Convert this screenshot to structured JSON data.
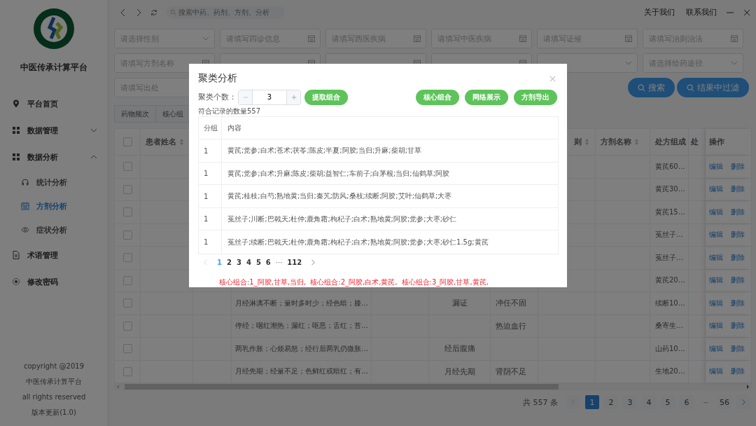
{
  "topbar": {
    "search": {
      "placeholder": "搜索中药、药剂、方剂、分析"
    },
    "links": [
      "关于我们",
      "联系我们"
    ]
  },
  "sidebar": {
    "title": "中医传承计算平台",
    "items": [
      {
        "label": "平台首页",
        "selected": false
      },
      {
        "label": "数据管理",
        "selected": false,
        "expanded": false
      },
      {
        "label": "数据分析",
        "selected": false,
        "expanded": true,
        "children": [
          {
            "label": "统计分析",
            "selected": false
          },
          {
            "label": "方剂分析",
            "selected": true
          },
          {
            "label": "症状分析",
            "selected": false
          }
        ]
      },
      {
        "label": "术语管理",
        "selected": false
      },
      {
        "label": "修改密码",
        "selected": false
      }
    ],
    "footer": [
      "copyright @2019",
      "中医传承计算平台",
      "all rights reserved",
      "版本更新(1.0)"
    ]
  },
  "filters": [
    {
      "kind": "select",
      "placeholder": "请选择性别"
    },
    {
      "kind": "date",
      "placeholder": "请填写四诊信息"
    },
    {
      "kind": "date",
      "placeholder": "请填写西医疾病"
    },
    {
      "kind": "date",
      "placeholder": "请填写中医疾病"
    },
    {
      "kind": "date",
      "placeholder": "请填写证候"
    },
    {
      "kind": "date",
      "placeholder": "请填写治则治法"
    },
    {
      "kind": "date",
      "placeholder": "请填写方剂名称"
    },
    {
      "kind": "date"
    },
    {
      "kind": "date"
    },
    {
      "kind": "date"
    },
    {
      "kind": "select"
    },
    {
      "kind": "select",
      "placeholder": "请选择给药途径"
    },
    {
      "kind": "text",
      "placeholder": "请填写出处"
    }
  ],
  "filter_buttons": [
    "搜索",
    "结果中过滤"
  ],
  "tabs": [
    {
      "label": "药物频次"
    },
    {
      "label": "核心组"
    }
  ],
  "table": {
    "all_checked": false,
    "headers": {
      "patient_name": {
        "label": "患者姓名",
        "sortable": true
      },
      "column_8": {
        "label": "则",
        "sortable": true
      },
      "formula_name": {
        "label": "方剂名称",
        "sortable": true
      },
      "composition": {
        "label": "处方组成",
        "sortable": false
      },
      "column_11": {
        "label": "处",
        "sortable": false
      },
      "actions": {
        "label": "操作",
        "sortable": false
      }
    },
    "rows": [
      {
        "checked": false,
        "composition": "黄芪60…",
        "actions": [
          "编辑",
          "删除"
        ]
      },
      {
        "checked": false,
        "composition": "黄芪30…",
        "actions": [
          "编辑",
          "删除"
        ]
      },
      {
        "checked": false,
        "composition": "黄芪15…",
        "actions": [
          "编辑",
          "删除"
        ]
      },
      {
        "checked": false,
        "composition": "菟丝子…",
        "actions": [
          "编辑",
          "删除"
        ]
      },
      {
        "checked": false,
        "composition": "菟丝子…",
        "actions": [
          "编辑",
          "删除"
        ]
      },
      {
        "checked": false,
        "composition": "黄芪20…",
        "actions": [
          "编辑",
          "删除"
        ]
      },
      {
        "checked": false,
        "symptoms": "月经淋漓不断；量时多时少；经色暗；膝…",
        "tcm_disease": "漏证",
        "syndrome": "冲任不固",
        "composition": "续断10…",
        "actions": [
          "编辑",
          "删除"
        ]
      },
      {
        "checked": false,
        "symptoms": "停经；咽红潮热；漏红；呕恶；舌红；苔…",
        "syndrome": "热迫血行",
        "composition": "桑寄生…",
        "actions": [
          "编辑",
          "删除"
        ]
      },
      {
        "checked": false,
        "symptoms": "两乳作胀；心烦易怒；经行后两乳仍微胀…",
        "tcm_disease": "经后腹痛",
        "composition": "山药10…",
        "actions": [
          "编辑",
          "删除"
        ]
      },
      {
        "checked": false,
        "symptoms": "月经先期；经量不足；色鲜红或暗红；有…",
        "tcm_disease": "月经先期",
        "syndrome": "肾阴不足",
        "composition": "生地20…",
        "actions": [
          "编辑",
          "删除"
        ]
      }
    ]
  },
  "pagination": {
    "total": "共 557 条",
    "pages": [
      {
        "label": "1",
        "kind": "page",
        "selected": true
      },
      {
        "label": "2",
        "kind": "page",
        "selected": false
      },
      {
        "label": "3",
        "kind": "page",
        "selected": false
      },
      {
        "label": "4",
        "kind": "page",
        "selected": false
      },
      {
        "label": "5",
        "kind": "page",
        "selected": false
      },
      {
        "label": "6",
        "kind": "page",
        "selected": false
      },
      {
        "label": "···",
        "kind": "ellipsis",
        "selected": false
      },
      {
        "label": "56",
        "kind": "page",
        "selected": false
      }
    ]
  },
  "dialog": {
    "title": "聚类分析",
    "count_label": "聚类个数：",
    "count_value": "3",
    "extract_button": "提取组合",
    "buttons": [
      "核心组合",
      "网络展示",
      "方剂导出"
    ],
    "record_count": "符合记录的数量557",
    "columns": [
      "分组",
      "内容"
    ],
    "rows": [
      {
        "group": "1",
        "content": "黄芪;党参;白术;苍术;茯苓;陈皮;半夏;阿胶;当归;升麻;柴胡;甘草"
      },
      {
        "group": "1",
        "content": "黄芪;党参;白术;升麻;陈皮;柴胡;益智仁;车前子;白茅根;当归;仙鹤草;阿胶"
      },
      {
        "group": "1",
        "content": "黄芪;桂枝;白芍;熟地黄;当归;秦艽;防风;桑枝;续断;阿胶;艾叶;仙鹤草;大枣"
      },
      {
        "group": "1",
        "content": "菟丝子;川断;巴戟天;杜仲;鹿角霜;枸杞子;白术;熟地黄;阿胶;党参;大枣;砂仁"
      },
      {
        "group": "1",
        "content": "菟丝子;续断;巴戟天;杜仲;鹿角霜;枸杞子;白术;熟地黄;阿胶;党参;大枣;砂仁1.5g;黄芪"
      }
    ],
    "pages": [
      {
        "label": "1",
        "kind": "page",
        "selected": true
      },
      {
        "label": "2",
        "kind": "page",
        "selected": false
      },
      {
        "label": "3",
        "kind": "page",
        "selected": false
      },
      {
        "label": "4",
        "kind": "page",
        "selected": false
      },
      {
        "label": "5",
        "kind": "page",
        "selected": false
      },
      {
        "label": "6",
        "kind": "page",
        "selected": false
      },
      {
        "label": "···",
        "kind": "ellipsis",
        "selected": false
      },
      {
        "label": "112",
        "kind": "page",
        "selected": false
      }
    ],
    "core_combinations": [
      "核心组合:1_阿胶,甘草,当归,",
      "核心组合:2_阿胶,白术,黄芪,",
      "核心组合:3_阿胶,甘草,黄芪,"
    ]
  }
}
